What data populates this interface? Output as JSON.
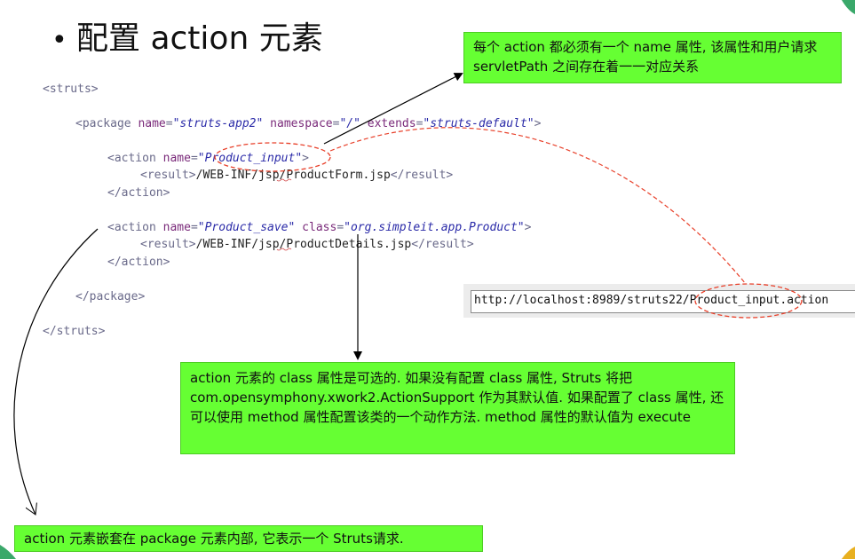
{
  "slide": {
    "title": "配置 action 元素",
    "bullet": "•"
  },
  "code": {
    "lines": [
      {
        "parts": [
          {
            "t": "tag",
            "v": "<struts>"
          }
        ]
      },
      {
        "parts": [
          {
            "t": "tag",
            "v": "<package "
          },
          {
            "t": "attr",
            "v": "name"
          },
          {
            "t": "tag",
            "v": "="
          },
          {
            "t": "val",
            "v": "\"struts-app2\""
          },
          {
            "t": "attr",
            "v": " namespace"
          },
          {
            "t": "tag",
            "v": "="
          },
          {
            "t": "val",
            "v": "\"/\""
          },
          {
            "t": "attr",
            "v": " extends"
          },
          {
            "t": "tag",
            "v": "="
          },
          {
            "t": "val",
            "v": "\"struts-default\""
          },
          {
            "t": "tag",
            "v": ">"
          }
        ]
      },
      {
        "parts": [
          {
            "t": "tag",
            "v": "<action "
          },
          {
            "t": "attr",
            "v": "name"
          },
          {
            "t": "tag",
            "v": "="
          },
          {
            "t": "val",
            "v": "\"Product_input\""
          },
          {
            "t": "tag",
            "v": ">"
          }
        ]
      },
      {
        "parts": [
          {
            "t": "tag",
            "v": "<result>"
          },
          {
            "t": "txt",
            "v": "/WEB-INF/jsp/ProductForm.jsp"
          },
          {
            "t": "tag",
            "v": "</result>"
          }
        ]
      },
      {
        "parts": [
          {
            "t": "tag",
            "v": "</action>"
          }
        ]
      },
      {
        "parts": [
          {
            "t": "tag",
            "v": "<action "
          },
          {
            "t": "attr",
            "v": "name"
          },
          {
            "t": "tag",
            "v": "="
          },
          {
            "t": "val",
            "v": "\"Product_save\""
          },
          {
            "t": "attr",
            "v": " class"
          },
          {
            "t": "tag",
            "v": "="
          },
          {
            "t": "val",
            "v": "\"org.simpleit.app.Product\""
          },
          {
            "t": "tag",
            "v": ">"
          }
        ]
      },
      {
        "parts": [
          {
            "t": "tag",
            "v": "<result>"
          },
          {
            "t": "txt",
            "v": "/WEB-INF/jsp/ProductDetails.jsp"
          },
          {
            "t": "tag",
            "v": "</result>"
          }
        ]
      },
      {
        "parts": [
          {
            "t": "tag",
            "v": "</action>"
          }
        ]
      },
      {
        "parts": [
          {
            "t": "tag",
            "v": "</package>"
          }
        ]
      },
      {
        "parts": [
          {
            "t": "tag",
            "v": "</struts>"
          }
        ]
      }
    ]
  },
  "callouts": {
    "name_attr": "每个 action 都必须有一个 name 属性, 该属性和用户请求 servletPath 之间存在着一一对应关系",
    "class_attr": "action 元素的 class 属性是可选的. 如果没有配置 class 属性, Struts 将把 com.opensymphony.xwork2.ActionSupport 作为其默认值.  如果配置了 class 属性, 还可以使用 method 属性配置该类的一个动作方法. method 属性的默认值为 execute",
    "nesting": "action 元素嵌套在 package 元素内部, 它表示一个 Struts请求."
  },
  "browser": {
    "url": "http://localhost:8989/struts22/Product_input.action"
  },
  "colors": {
    "callout_bg": "#66ff33",
    "highlight_ellipse": "#e8402a"
  }
}
